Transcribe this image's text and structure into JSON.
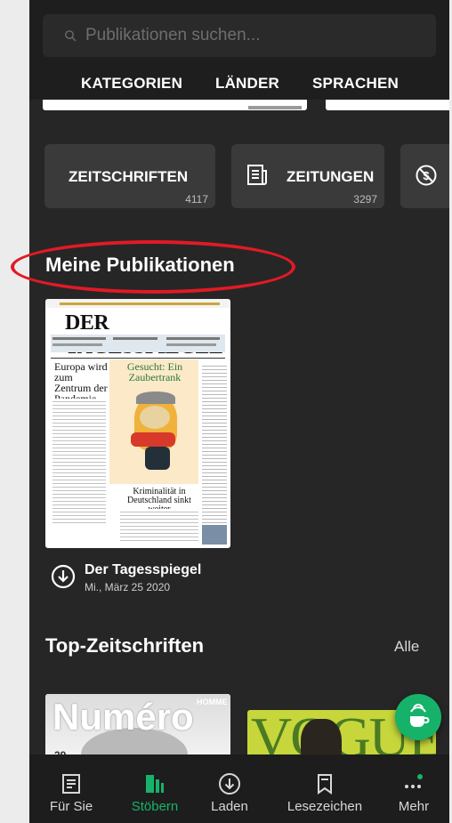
{
  "search": {
    "placeholder": "Publikationen suchen..."
  },
  "tabs": [
    "KATEGORIEN",
    "LÄNDER",
    "SPRACHEN"
  ],
  "categories": [
    {
      "label": "ZEITSCHRIFTEN",
      "count": "4117"
    },
    {
      "label": "ZEITUNGEN",
      "count": "3297"
    }
  ],
  "my_publications": {
    "title": "Meine Publikationen",
    "item": {
      "masthead": "DER TAGESSPIEGEL",
      "headline_left": "Europa wird zum Zentrum der Pandemie",
      "headline_center": "Gesucht: Ein Zaubertrank",
      "headline_bottom": "Kriminalität in Deutschland sinkt weiter",
      "name": "Der Tagesspiegel",
      "date": "Mi., März 25 2020"
    }
  },
  "top_magazines": {
    "title": "Top-Zeitschriften",
    "link": "Alle",
    "covers": [
      {
        "title": "Numéro",
        "subtitle": "HOMME",
        "issue": "39"
      },
      {
        "title": "VOGUE"
      }
    ]
  },
  "bottom_nav": [
    {
      "label": "Für Sie",
      "icon": "article-icon",
      "active": false
    },
    {
      "label": "Stöbern",
      "icon": "browse-icon",
      "active": true
    },
    {
      "label": "Laden",
      "icon": "download-icon",
      "active": false
    },
    {
      "label": "Lesezeichen",
      "icon": "bookmark-icon",
      "active": false
    },
    {
      "label": "Mehr",
      "icon": "more-icon",
      "active": false
    }
  ],
  "colors": {
    "accent": "#17b26a",
    "background": "#262626",
    "annotation": "#e11a26"
  }
}
